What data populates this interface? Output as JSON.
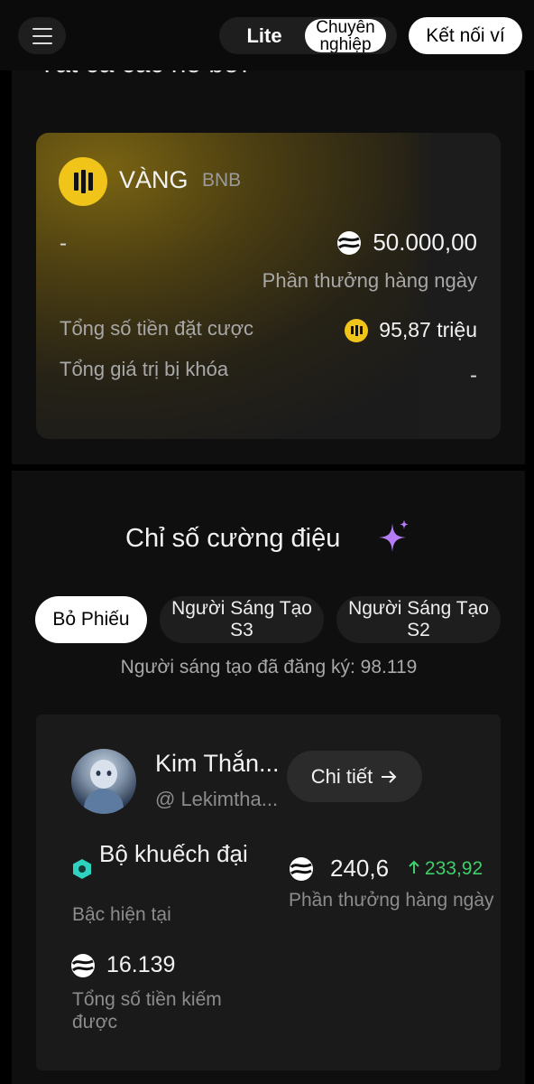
{
  "header": {
    "mode_lite": "Lite",
    "mode_pro": "Chuyên nghiệp",
    "connect_wallet": "Kết nối ví"
  },
  "pools": {
    "peek_title": "Tất cả các hồ bơi",
    "card": {
      "tier": "VÀNG",
      "chain": "BNB",
      "left_value": "-",
      "daily_reward": "50.000,00",
      "daily_reward_label": "Phần thưởng hàng ngày",
      "total_staked_label": "Tổng số tiền đặt cược",
      "total_staked": "95,87 triệu",
      "tvl_label": "Tổng giá trị bị khóa",
      "tvl": "-"
    }
  },
  "hype": {
    "title": "Chỉ số cường điệu",
    "tabs": [
      "Bỏ Phiếu",
      "Người Sáng Tạo S3",
      "Người Sáng Tạo S2"
    ],
    "registered": "Người sáng tạo đã đăng ký: 98.119",
    "creator": {
      "name": "Kim Thắn...",
      "handle": "@ Lekimtha...",
      "detail_button": "Chi tiết",
      "rank": "Bộ khuếch đại",
      "rank_label": "Bậc hiện tại",
      "daily_reward": "240,6",
      "daily_change": "233,92",
      "daily_label": "Phần thưởng hàng ngày",
      "total_earned": "16.139",
      "total_earned_label": "Tổng số tiền kiếm được"
    }
  },
  "colors": {
    "gold": "#f0c419",
    "positive": "#3ecf6a",
    "sparkle": "#b57cf5",
    "rank_icon": "#2ed3c0"
  }
}
